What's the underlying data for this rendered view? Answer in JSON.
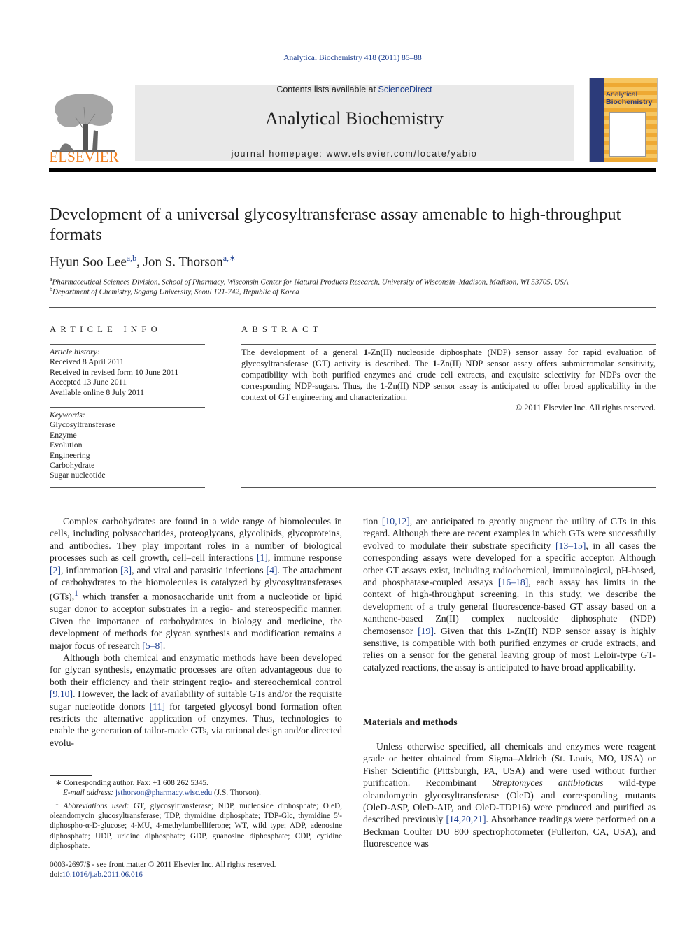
{
  "header": {
    "journal_ref": "Analytical Biochemistry 418 (2011) 85–88",
    "contents_prefix": "Contents lists available at ",
    "contents_link": "ScienceDirect",
    "journal_name": "Analytical Biochemistry",
    "homepage": "journal homepage: www.elsevier.com/locate/yabio",
    "publisher_logo_text": "ELSEVIER",
    "cover_title_1": "Analytical",
    "cover_title_2": "Biochemistry",
    "colors": {
      "link": "#1b3d8f",
      "elsevier_orange": "#f07c1b",
      "masthead_bg": "#e9e9e9"
    }
  },
  "article": {
    "title": "Development of a universal glycosyltransferase assay amenable to high-throughput formats",
    "authors": [
      {
        "name": "Hyun Soo Lee",
        "sup": "a,b",
        "separator": ", "
      },
      {
        "name": "Jon S. Thorson",
        "sup": "a,∗",
        "separator": ""
      }
    ],
    "affiliations": [
      {
        "label": "a",
        "text": "Pharmaceutical Sciences Division, School of Pharmacy, Wisconsin Center for Natural Products Research, University of Wisconsin–Madison, Madison, WI 53705, USA"
      },
      {
        "label": "b",
        "text": "Department of Chemistry, Sogang University, Seoul 121-742, Republic of Korea"
      }
    ]
  },
  "article_info": {
    "heading": "ARTICLE INFO",
    "history_label": "Article history:",
    "history": [
      "Received 8 April 2011",
      "Received in revised form 10 June 2011",
      "Accepted 13 June 2011",
      "Available online 8 July 2011"
    ],
    "keywords_label": "Keywords:",
    "keywords": [
      "Glycosyltransferase",
      "Enzyme",
      "Evolution",
      "Engineering",
      "Carbohydrate",
      "Sugar nucleotide"
    ]
  },
  "abstract": {
    "heading": "ABSTRACT",
    "parts": [
      "The development of a general ",
      "1",
      "-Zn(II) nucleoside diphosphate (NDP) sensor assay for rapid evaluation of glycosyltransferase (GT) activity is described. The ",
      "1",
      "-Zn(II) NDP sensor assay offers submicromolar sensitivity, compatibility with both purified enzymes and crude cell extracts, and exquisite selectivity for NDPs over the corresponding NDP-sugars. Thus, the ",
      "1",
      "-Zn(II) NDP sensor assay is anticipated to offer broad applicability in the context of GT engineering and characterization."
    ],
    "copyright": "© 2011 Elsevier Inc. All rights reserved."
  },
  "body": {
    "left_p1": [
      "Complex carbohydrates are found in a wide range of biomolecules in cells, including polysaccharides, proteoglycans, glycolipids, glycoproteins, and antibodies. They play important roles in a number of biological processes such as cell growth, cell–cell interactions ",
      "[1]",
      ", immune response ",
      "[2]",
      ", inflammation ",
      "[3]",
      ", and viral and parasitic infections ",
      "[4]",
      ". The attachment of carbohydrates to the biomolecules is catalyzed by glycosyltransferases (GTs),",
      "1",
      " which transfer a monosaccharide unit from a nucleotide or lipid sugar donor to acceptor substrates in a regio- and stereospecific manner. Given the importance of carbohydrates in biology and medicine, the development of methods for glycan synthesis and modification remains a major focus of research ",
      "[5–8]",
      "."
    ],
    "left_p2": [
      "Although both chemical and enzymatic methods have been developed for glycan synthesis, enzymatic processes are often advantageous due to both their efficiency and their stringent regio- and stereochemical control ",
      "[9,10]",
      ". However, the lack of availability of suitable GTs and/or the requisite sugar nucleotide donors ",
      "[11]",
      " for targeted glycosyl bond formation often restricts the alternative application of enzymes. Thus, technologies to enable the generation of tailor-made GTs, via rational design and/or directed evolu-"
    ],
    "right_p1": [
      "tion ",
      "[10,12]",
      ", are anticipated to greatly augment the utility of GTs in this regard. Although there are recent examples in which GTs were successfully evolved to modulate their substrate specificity ",
      "[13–15]",
      ", in all cases the corresponding assays were developed for a specific acceptor. Although other GT assays exist, including radiochemical, immunological, pH-based, and phosphatase-coupled assays ",
      "[16–18]",
      ", each assay has limits in the context of high-throughput screening. In this study, we describe the development of a truly general fluorescence-based GT assay based on a xanthene-based Zn(II) complex nucleoside diphosphate (NDP) chemosensor ",
      "[19]",
      ". Given that this ",
      "1",
      "-Zn(II) NDP sensor assay is highly sensitive, is compatible with both purified enzymes or crude extracts, and relies on a sensor for the general leaving group of most Leloir-type GT-catalyzed reactions, the assay is anticipated to have broad applicability."
    ],
    "methods_heading": "Materials and methods",
    "right_p2": [
      "Unless otherwise specified, all chemicals and enzymes were reagent grade or better obtained from Sigma–Aldrich (St. Louis, MO, USA) or Fisher Scientific (Pittsburgh, PA, USA) and were used without further purification. Recombinant ",
      "Streptomyces antibioticus",
      " wild-type oleandomycin glycosyltransferase (OleD) and corresponding mutants (OleD-ASP, OleD-AIP, and OleD-TDP16) were produced and purified as described previously ",
      "[14,20,21]",
      ". Absorbance readings were performed on a Beckman Coulter DU 800 spectrophotometer (Fullerton, CA, USA), and fluorescence was"
    ]
  },
  "footnotes": {
    "corresponding": "∗  Corresponding author. Fax: +1 608 262 5345.",
    "email_label": "E-mail address: ",
    "email": "jsthorson@pharmacy.wisc.edu",
    "email_suffix": " (J.S. Thorson).",
    "abbrev_mark": "1",
    "abbrev_label": "Abbreviations used: ",
    "abbrev_text": "GT, glycosyltransferase; NDP, nucleoside diphosphate; OleD, oleandomycin glucosyltransferase; TDP, thymidine diphosphate; TDP-Glc, thymidine 5′-diphospho-α-D-glucose; 4-MU, 4-methylumbelliferone; WT, wild type; ADP, adenosine diphosphate; UDP, uridine diphosphate; GDP, guanosine diphosphate; CDP, cytidine diphosphate.",
    "front_matter": "0003-2697/$ - see front matter © 2011 Elsevier Inc. All rights reserved.",
    "doi_label": "doi:",
    "doi": "10.1016/j.ab.2011.06.016"
  }
}
